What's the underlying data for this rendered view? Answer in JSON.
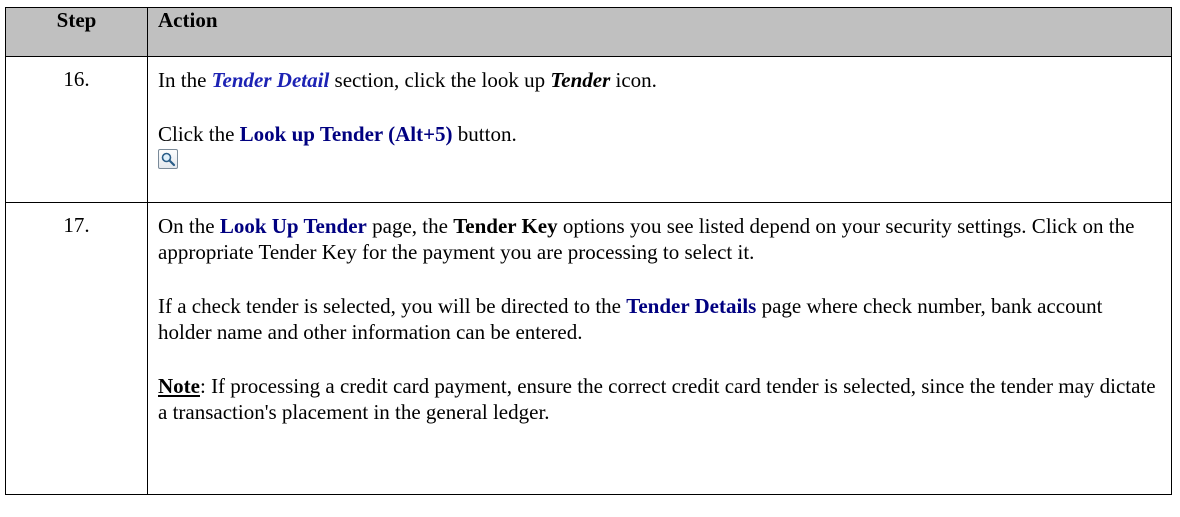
{
  "header": {
    "step": "Step",
    "action": "Action"
  },
  "rows": [
    {
      "number": "16.",
      "p1": {
        "a": "In the ",
        "b": "Tender Detail",
        "c": " section, click the look up ",
        "d": "Tender",
        "e": " icon."
      },
      "p2": {
        "a": "Click the ",
        "b": "Look up Tender (Alt+5)",
        "c": " button."
      },
      "icon": "magnifier-lookup-icon"
    },
    {
      "number": "17.",
      "p1": {
        "a": "On the ",
        "b": "Look Up Tender",
        "c": " page, the ",
        "d": "Tender Key",
        "e": " options you see listed depend on your security settings. Click on the appropriate Tender Key for the payment you are processing to select it."
      },
      "p2": {
        "a": "If a check tender is selected, you will be directed to the ",
        "b": "Tender Details",
        "c": " page where check number, bank account holder name and other information can be entered."
      },
      "p3": {
        "a": "Note",
        "b": ": If processing a credit card payment, ensure the correct credit card tender is selected, since the tender may dictate a transaction's placement in the general ledger."
      }
    }
  ]
}
